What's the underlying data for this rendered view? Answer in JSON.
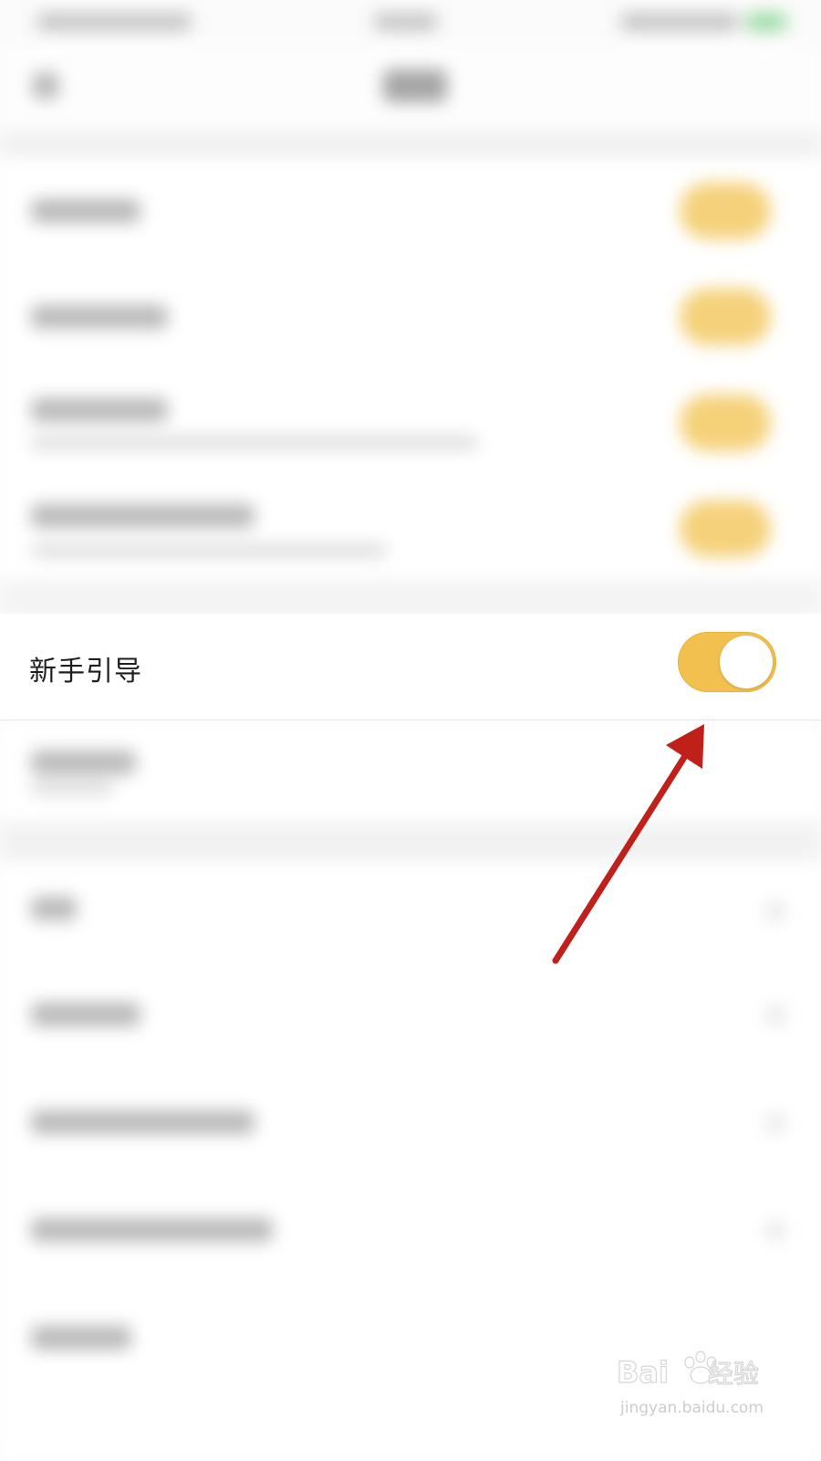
{
  "setting": {
    "label": "新手引导",
    "toggle_state": "on"
  },
  "colors": {
    "toggle_on": "#f2c04f",
    "annotation_arrow": "#c0201a",
    "background": "#fbfbfb"
  },
  "watermark": {
    "brand": "Baidu经验",
    "url": "jingyan.baidu.com"
  }
}
